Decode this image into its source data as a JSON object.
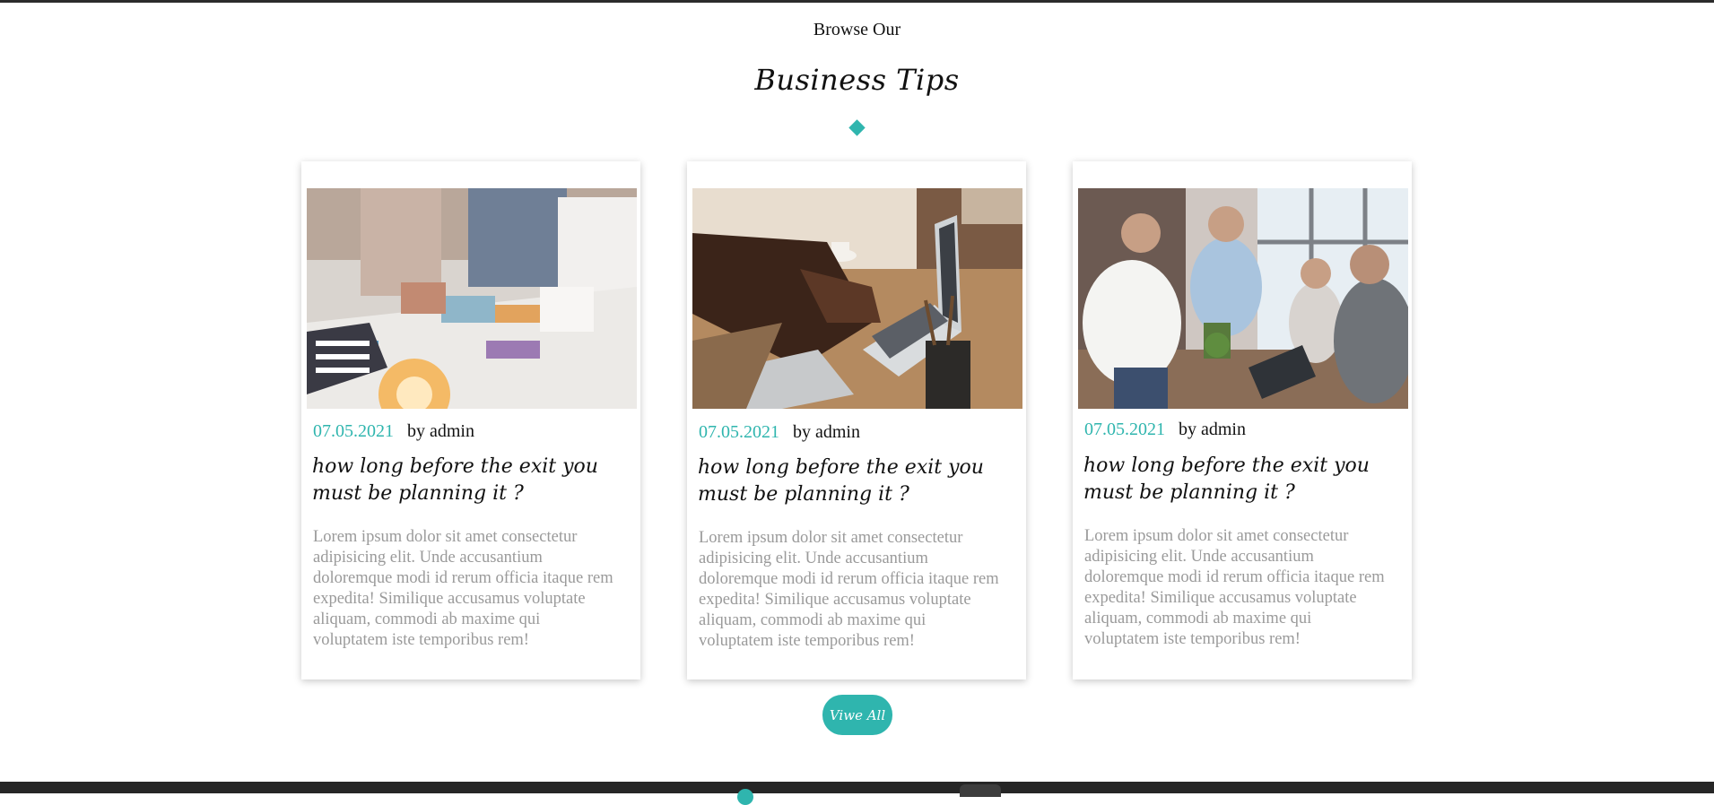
{
  "section": {
    "eyebrow": "Browse Our",
    "title": "Business Tips"
  },
  "posts": [
    {
      "date": "07.05.2021",
      "author": "by admin",
      "title": "how long before the exit you must be planning it ?",
      "body": "Lorem ipsum dolor sit amet consectetur adipisicing elit. Unde accusantium doloremque modi id rerum officia itaque rem expedita! Similique accusamus voluptate aliquam, commodi ab maxime qui voluptatem iste temporibus rem!"
    },
    {
      "date": "07.05.2021",
      "author": "by admin",
      "title": "how long before the exit you must be planning it ?",
      "body": "Lorem ipsum dolor sit amet consectetur adipisicing elit. Unde accusantium doloremque modi id rerum officia itaque rem expedita! Similique accusamus voluptate aliquam, commodi ab maxime qui voluptatem iste temporibus rem!"
    },
    {
      "date": "07.05.2021",
      "author": "by admin",
      "title": "how long before the exit you must be planning it ?",
      "body": "Lorem ipsum dolor sit amet consectetur adipisicing elit. Unde accusantium doloremque modi id rerum officia itaque rem expedita! Similique accusamus voluptate aliquam, commodi ab maxime qui voluptatem iste temporibus rem!"
    }
  ],
  "view_all_label": "Viwe All",
  "colors": {
    "accent": "#2fb5ae",
    "muted_text": "#9a9a9a",
    "footer": "#262626"
  }
}
